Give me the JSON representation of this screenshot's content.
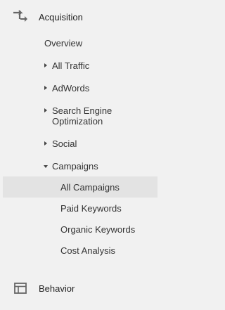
{
  "acquisition": {
    "label": "Acquisition",
    "icon": "acquisition-arrows-icon",
    "overview": "Overview",
    "items": [
      {
        "label": "All Traffic",
        "state": "collapsed"
      },
      {
        "label": "AdWords",
        "state": "collapsed"
      },
      {
        "label": "Search Engine Optimization",
        "line1": "Search Engine",
        "line2": "Optimization",
        "state": "collapsed"
      },
      {
        "label": "Social",
        "state": "collapsed"
      },
      {
        "label": "Campaigns",
        "state": "expanded"
      }
    ],
    "campaigns": [
      {
        "label": "All Campaigns",
        "selected": true
      },
      {
        "label": "Paid Keywords",
        "selected": false
      },
      {
        "label": "Organic Keywords",
        "selected": false
      },
      {
        "label": "Cost Analysis",
        "selected": false
      }
    ]
  },
  "behavior": {
    "label": "Behavior",
    "icon": "behavior-layout-icon"
  },
  "colors": {
    "background": "#f1f1f1",
    "selected_background": "#e3e3e3",
    "icon": "#666666"
  }
}
